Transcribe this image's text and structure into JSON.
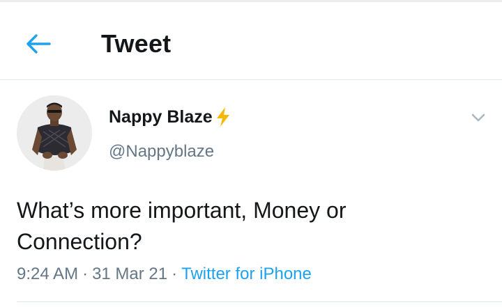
{
  "header": {
    "back_icon": "arrow-left-icon",
    "title": "Tweet"
  },
  "tweet": {
    "author_name": "Nappy Blaze",
    "author_emoji_icon": "lightning-bolt-icon",
    "handle": "@Nappyblaze",
    "text": "What’s more important, Money or Connection?",
    "time": "9:24 AM",
    "date": "31 Mar 21",
    "source": "Twitter for iPhone",
    "separator": "·"
  },
  "colors": {
    "accent": "#1da1f2",
    "text_primary": "#14171a",
    "text_secondary": "#657786",
    "bolt": "#f5b800"
  }
}
